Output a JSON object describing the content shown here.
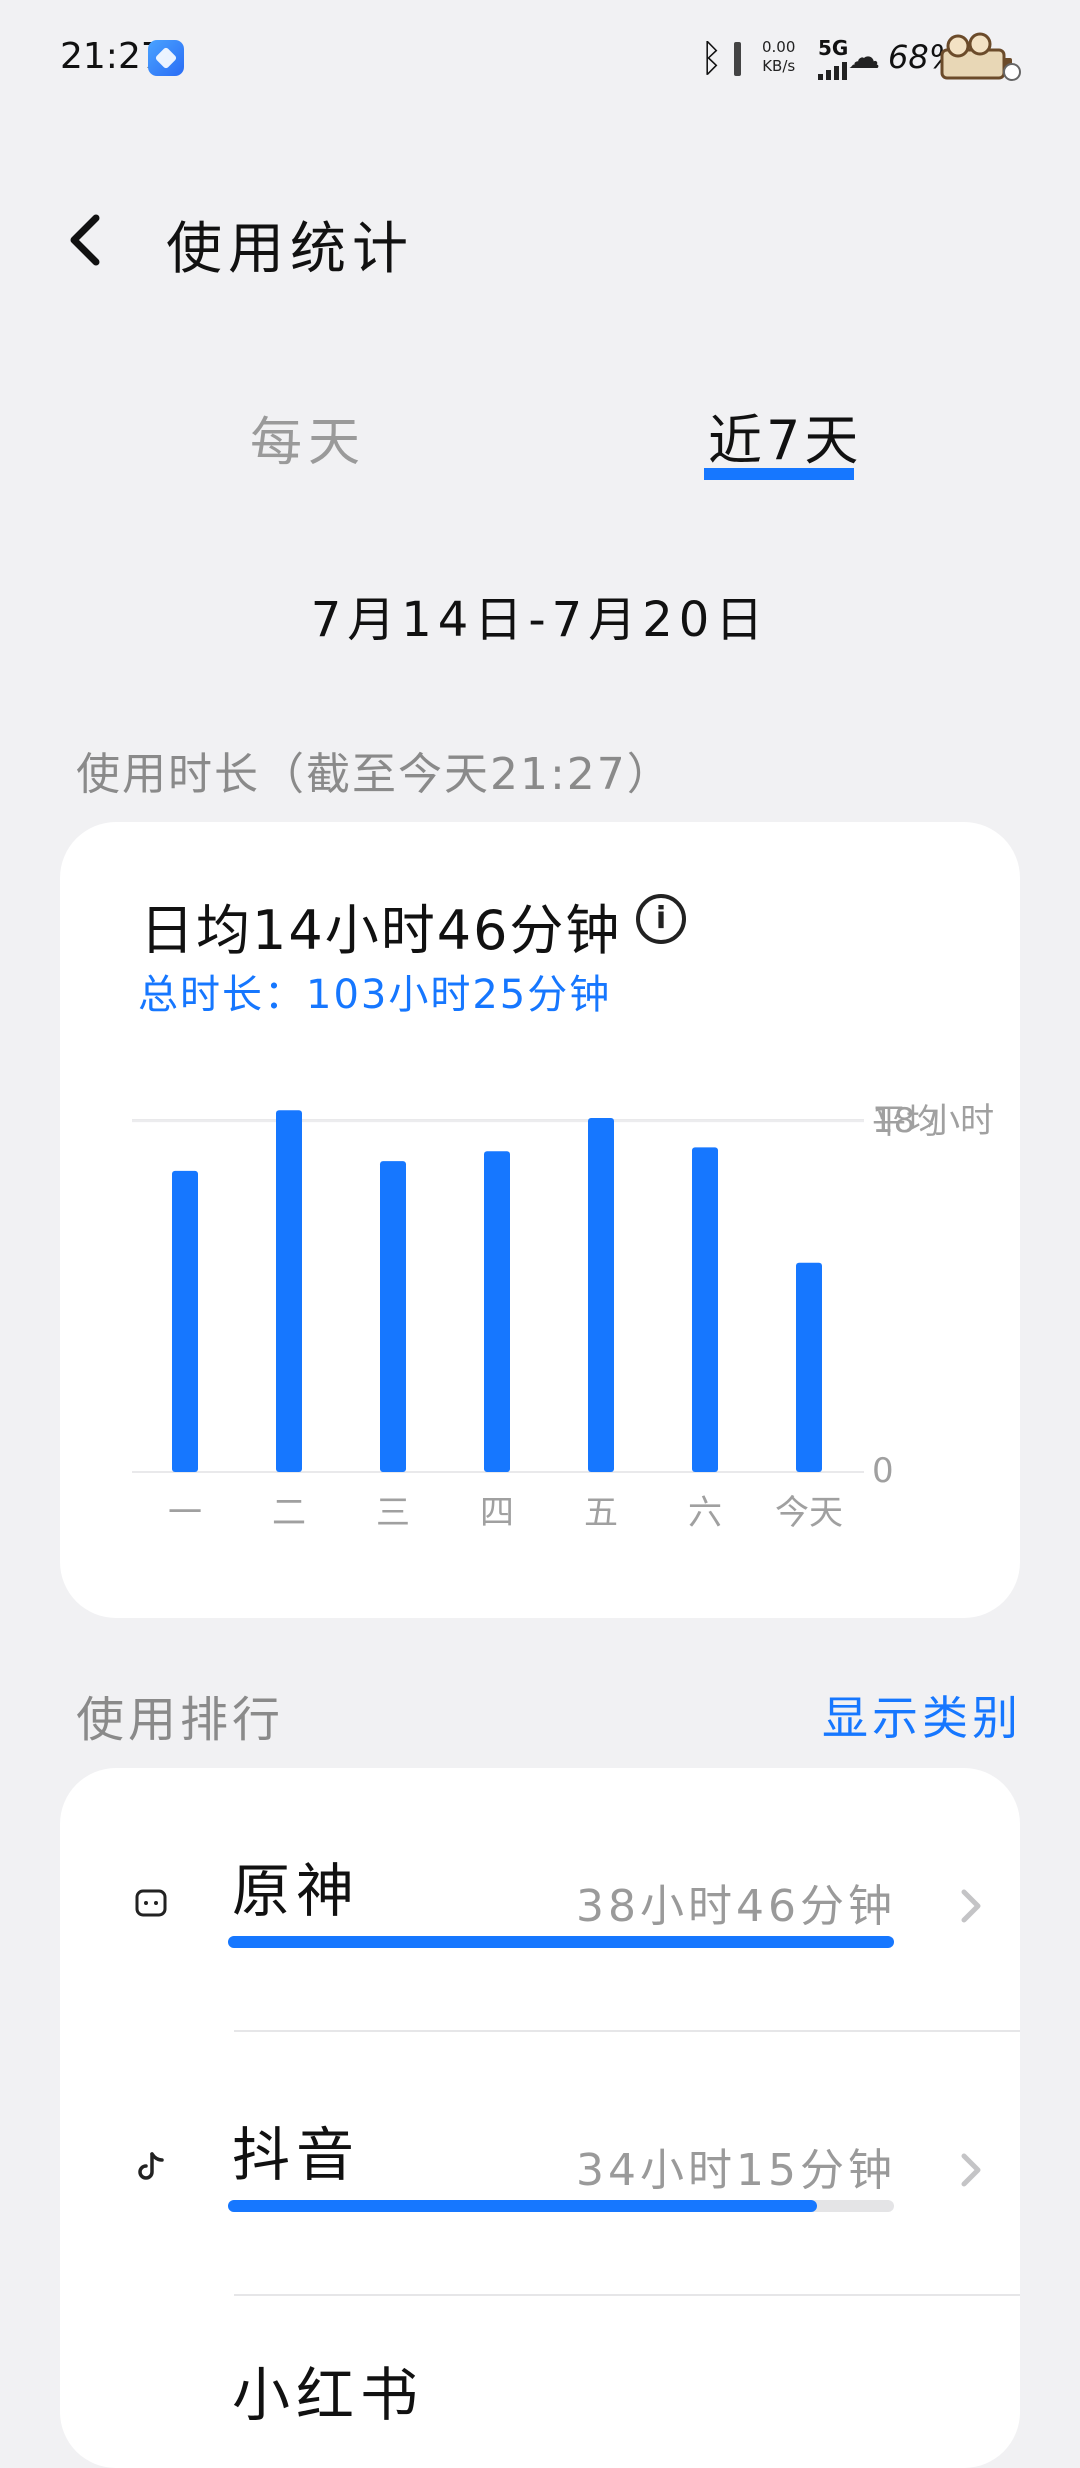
{
  "status_bar": {
    "time": "21:27",
    "net_speed_value": "0.00",
    "net_speed_unit": "KB/s",
    "network": "5G",
    "battery": "68%"
  },
  "header": {
    "title": "使用统计"
  },
  "tabs": [
    {
      "label": "每天",
      "active": false
    },
    {
      "label": "近7天",
      "active": true
    }
  ],
  "date_range": "7月14日-7月20日",
  "usage": {
    "section_label": "使用时长（截至今天21:27）",
    "average_text": "日均14小时46分钟",
    "total_text": "总时长：103小时25分钟"
  },
  "chart_data": {
    "type": "bar",
    "categories": [
      "一",
      "二",
      "三",
      "四",
      "五",
      "六",
      "今天"
    ],
    "values": [
      15.4,
      18.5,
      15.9,
      16.4,
      18.1,
      16.6,
      10.7
    ],
    "unit": "小时",
    "ylim": [
      0,
      18
    ],
    "max_label": "18 小时",
    "avg_label": "平均",
    "average": 14.77,
    "zero_label": "0",
    "bar_color": "#1677ff",
    "grid": true
  },
  "ranking": {
    "section_label": "使用排行",
    "show_category_label": "显示类别",
    "items": [
      {
        "name": "原神",
        "time": "38小时46分钟",
        "fraction": 1.0,
        "icon": "genshin-icon"
      },
      {
        "name": "抖音",
        "time": "34小时15分钟",
        "fraction": 0.884,
        "icon": "douyin-icon"
      },
      {
        "name": "小红书",
        "time": "",
        "fraction": 0.5,
        "icon": "app-icon"
      }
    ]
  },
  "colors": {
    "accent": "#1677ff",
    "background": "#f1f1f3",
    "card": "#ffffff",
    "muted": "#9a9a9a"
  }
}
